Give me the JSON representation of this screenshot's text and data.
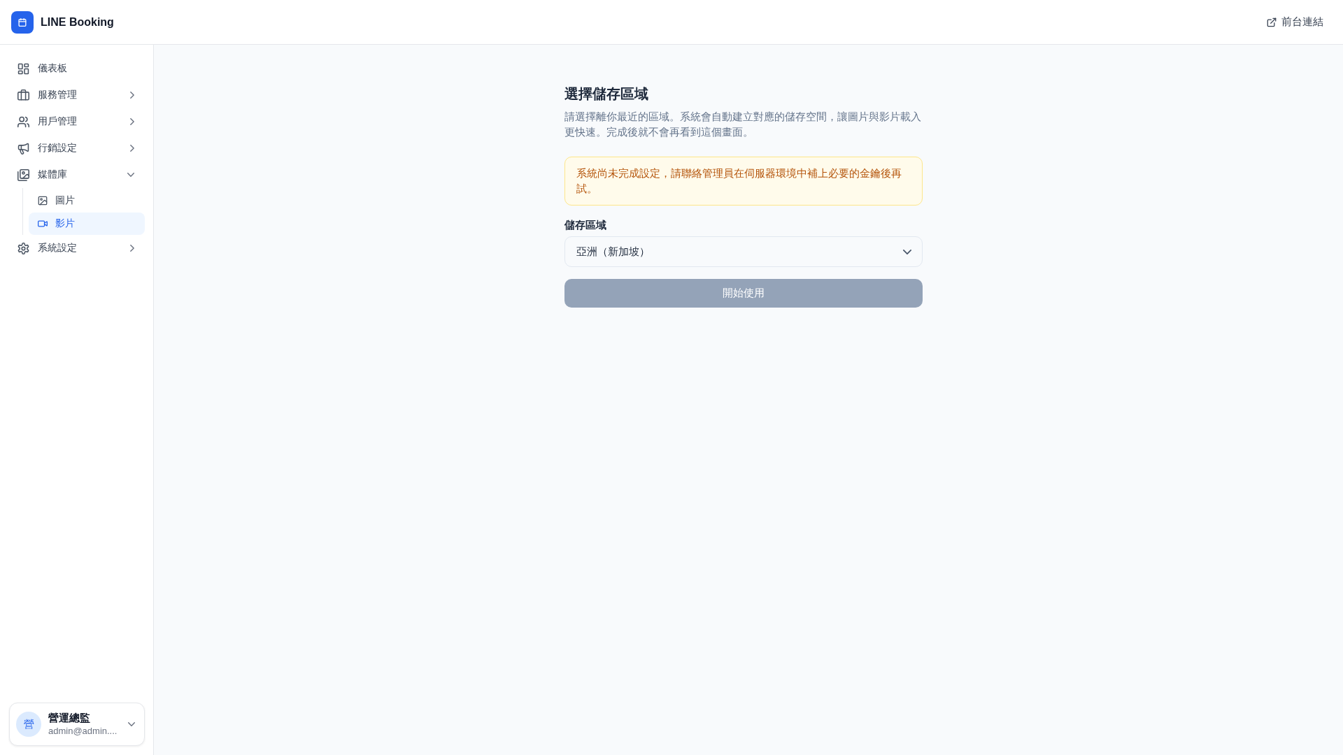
{
  "header": {
    "app_name": "LINE Booking",
    "frontend_link": "前台連結"
  },
  "sidebar": {
    "items": [
      {
        "label": "儀表板",
        "kind": "link",
        "selected": false
      },
      {
        "label": "服務管理",
        "kind": "group",
        "expanded": false,
        "selected": false
      },
      {
        "label": "用戶管理",
        "kind": "group",
        "expanded": false,
        "selected": false
      },
      {
        "label": "行銷設定",
        "kind": "group",
        "expanded": false,
        "selected": false
      },
      {
        "label": "媒體庫",
        "kind": "group",
        "expanded": true,
        "selected": false,
        "children": [
          {
            "label": "圖片",
            "selected": false
          },
          {
            "label": "影片",
            "selected": true
          }
        ]
      },
      {
        "label": "系統設定",
        "kind": "group",
        "expanded": false,
        "selected": false
      }
    ],
    "user": {
      "avatar": "營",
      "name": "營運總監",
      "email": "admin@admin...."
    }
  },
  "main": {
    "title": "選擇儲存區域",
    "description": "請選擇離你最近的區域。系統會自動建立對應的儲存空間，讓圖片與影片載入更快速。完成後就不會再看到這個畫面。",
    "alert": {
      "message": "系統尚未完成設定，請聯絡管理員在伺服器環境中補上必要的金鑰後再試。"
    },
    "region_field": {
      "label": "儲存區域",
      "value": "亞洲（新加坡）"
    },
    "start_button": {
      "label": "開始使用",
      "disabled": true
    }
  }
}
